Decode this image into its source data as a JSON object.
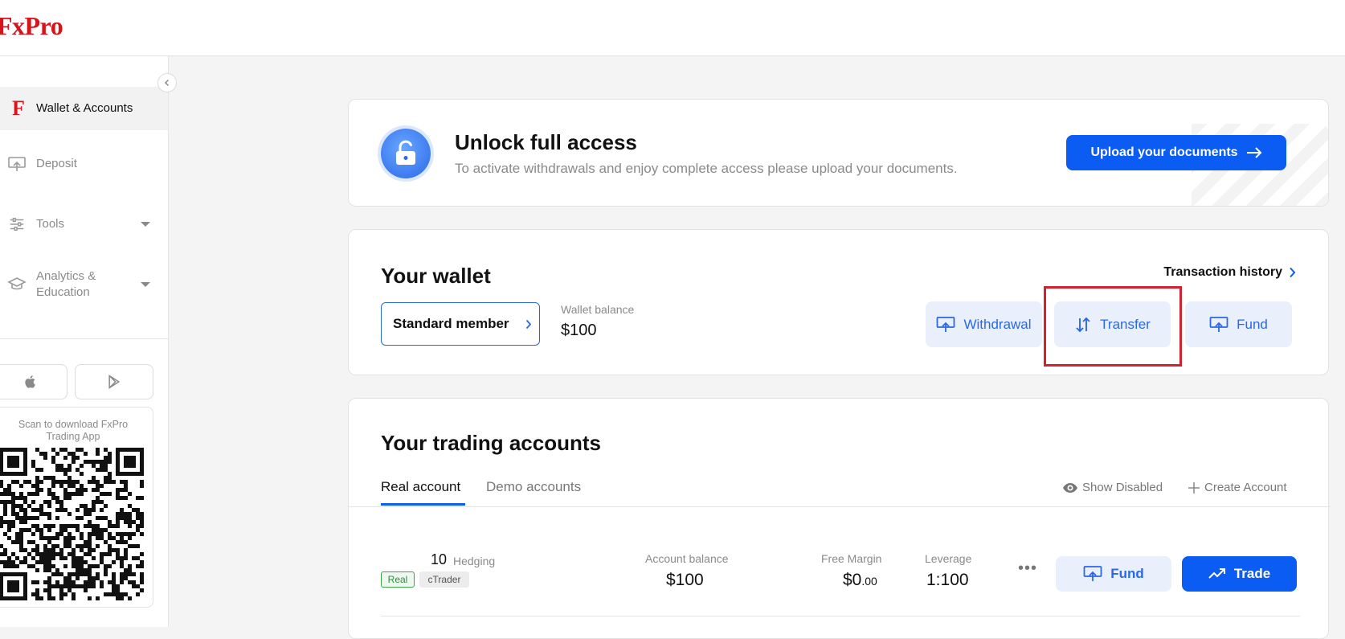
{
  "header": {
    "logo": "FxPro"
  },
  "sidebar": {
    "items": [
      {
        "label": "Wallet & Accounts",
        "icon": "fxpro-f-icon",
        "active": true
      },
      {
        "label": "Deposit",
        "icon": "deposit-icon"
      },
      {
        "label": "Tools",
        "icon": "sliders-icon",
        "expandable": true
      },
      {
        "label": "Analytics & Education",
        "icon": "graduation-cap-icon",
        "expandable": true
      }
    ],
    "app_stores": [
      "apple-icon",
      "google-play-icon"
    ],
    "qr_caption": "Scan to download FxPro Trading App"
  },
  "unlock_banner": {
    "title": "Unlock full access",
    "subtitle": "To activate withdrawals and enjoy complete access please upload your documents.",
    "button": "Upload your documents"
  },
  "wallet": {
    "title": "Your wallet",
    "transaction_history": "Transaction history",
    "membership": "Standard member",
    "balance_label": "Wallet balance",
    "balance_value": "$100",
    "actions": {
      "withdrawal": "Withdrawal",
      "transfer": "Transfer",
      "fund": "Fund"
    }
  },
  "trading_accounts": {
    "title": "Your trading accounts",
    "tabs": [
      "Real account",
      "Demo accounts"
    ],
    "show_disabled": "Show Disabled",
    "create_account": "Create Account",
    "account": {
      "number": "10",
      "mode": "Hedging",
      "badges": [
        "Real",
        "cTrader"
      ],
      "balance_label": "Account balance",
      "balance_value": "$100",
      "free_margin_label": "Free Margin",
      "free_margin_main": "$0",
      "free_margin_cents": ".00",
      "leverage_label": "Leverage",
      "leverage_value": "1:100",
      "more": "•••",
      "fund": "Fund",
      "trade": "Trade"
    }
  },
  "colors": {
    "brand_red": "#d7131b",
    "primary_blue": "#0b5cf3",
    "soft_blue": "#e9f0fc",
    "highlight_red": "#d0222f"
  }
}
